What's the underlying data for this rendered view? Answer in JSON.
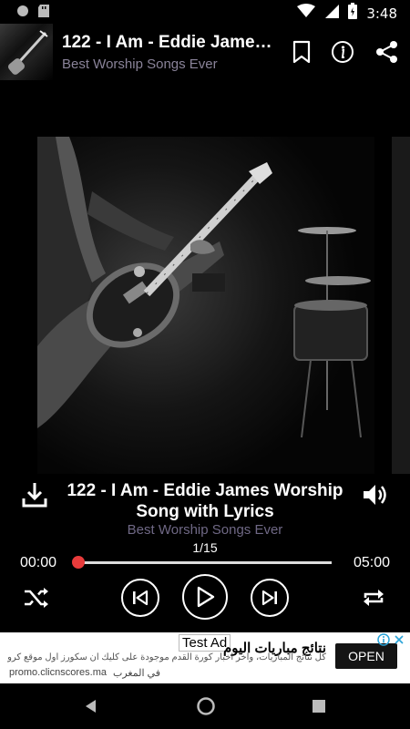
{
  "status_bar": {
    "time": "3:48"
  },
  "header": {
    "title": "122 - I Am - Eddie James Worship Song with Lyrics",
    "subtitle": "Best Worship Songs Ever",
    "icons": [
      "bookmark-icon",
      "info-icon",
      "share-icon"
    ]
  },
  "player": {
    "song_title": "122 - I Am - Eddie James Worship Song with Lyrics",
    "playlist": "Best Worship Songs Ever",
    "track_position": "1/15",
    "current_time": "00:00",
    "total_time": "05:00",
    "progress": 0,
    "accent_color": "#e83b3b"
  },
  "ad": {
    "label": "Test Ad",
    "title": "نتائج مباريات اليوم",
    "description": "كل نتائج المباريات، وآخر أخبار كورة القدم موجودة على كليك ان سكورز أول موقع كروي",
    "url": "promo.clicnscores.ma",
    "region": "في المغرب",
    "open_label": "OPEN"
  }
}
